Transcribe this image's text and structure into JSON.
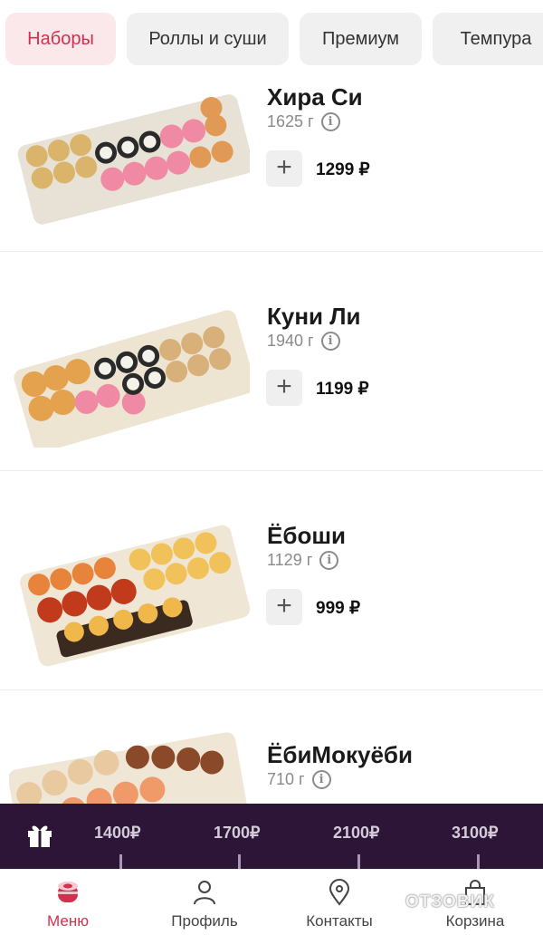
{
  "tabs": [
    {
      "label": "Наборы",
      "active": true
    },
    {
      "label": "Роллы и суши",
      "active": false
    },
    {
      "label": "Премиум",
      "active": false
    },
    {
      "label": "Темпура",
      "active": false
    }
  ],
  "products": [
    {
      "name": "Хира Си",
      "weight": "1625 г",
      "price": "1299 ₽"
    },
    {
      "name": "Куни Ли",
      "weight": "1940 г",
      "price": "1199 ₽"
    },
    {
      "name": "Ёбоши",
      "weight": "1129 г",
      "price": "999 ₽"
    },
    {
      "name": "ЁбиМокуёби",
      "weight": "710 г",
      "price": ""
    }
  ],
  "add_symbol": "+",
  "info_symbol": "i",
  "bonus_bar": {
    "tiers": [
      "1400₽",
      "1700₽",
      "2100₽",
      "3100₽"
    ],
    "icon": "gift-icon"
  },
  "nav": [
    {
      "label": "Меню",
      "icon": "sushi-icon",
      "active": true
    },
    {
      "label": "Профиль",
      "icon": "user-icon",
      "active": false
    },
    {
      "label": "Контакты",
      "icon": "location-pin-icon",
      "active": false
    },
    {
      "label": "Корзина",
      "icon": "shopping-bag-icon",
      "active": false
    }
  ],
  "watermark": "ОТЗОВИК",
  "colors": {
    "accent": "#d32f4f",
    "bonus_bg": "#2d1537",
    "tab_active_bg": "#fbe8ea"
  }
}
